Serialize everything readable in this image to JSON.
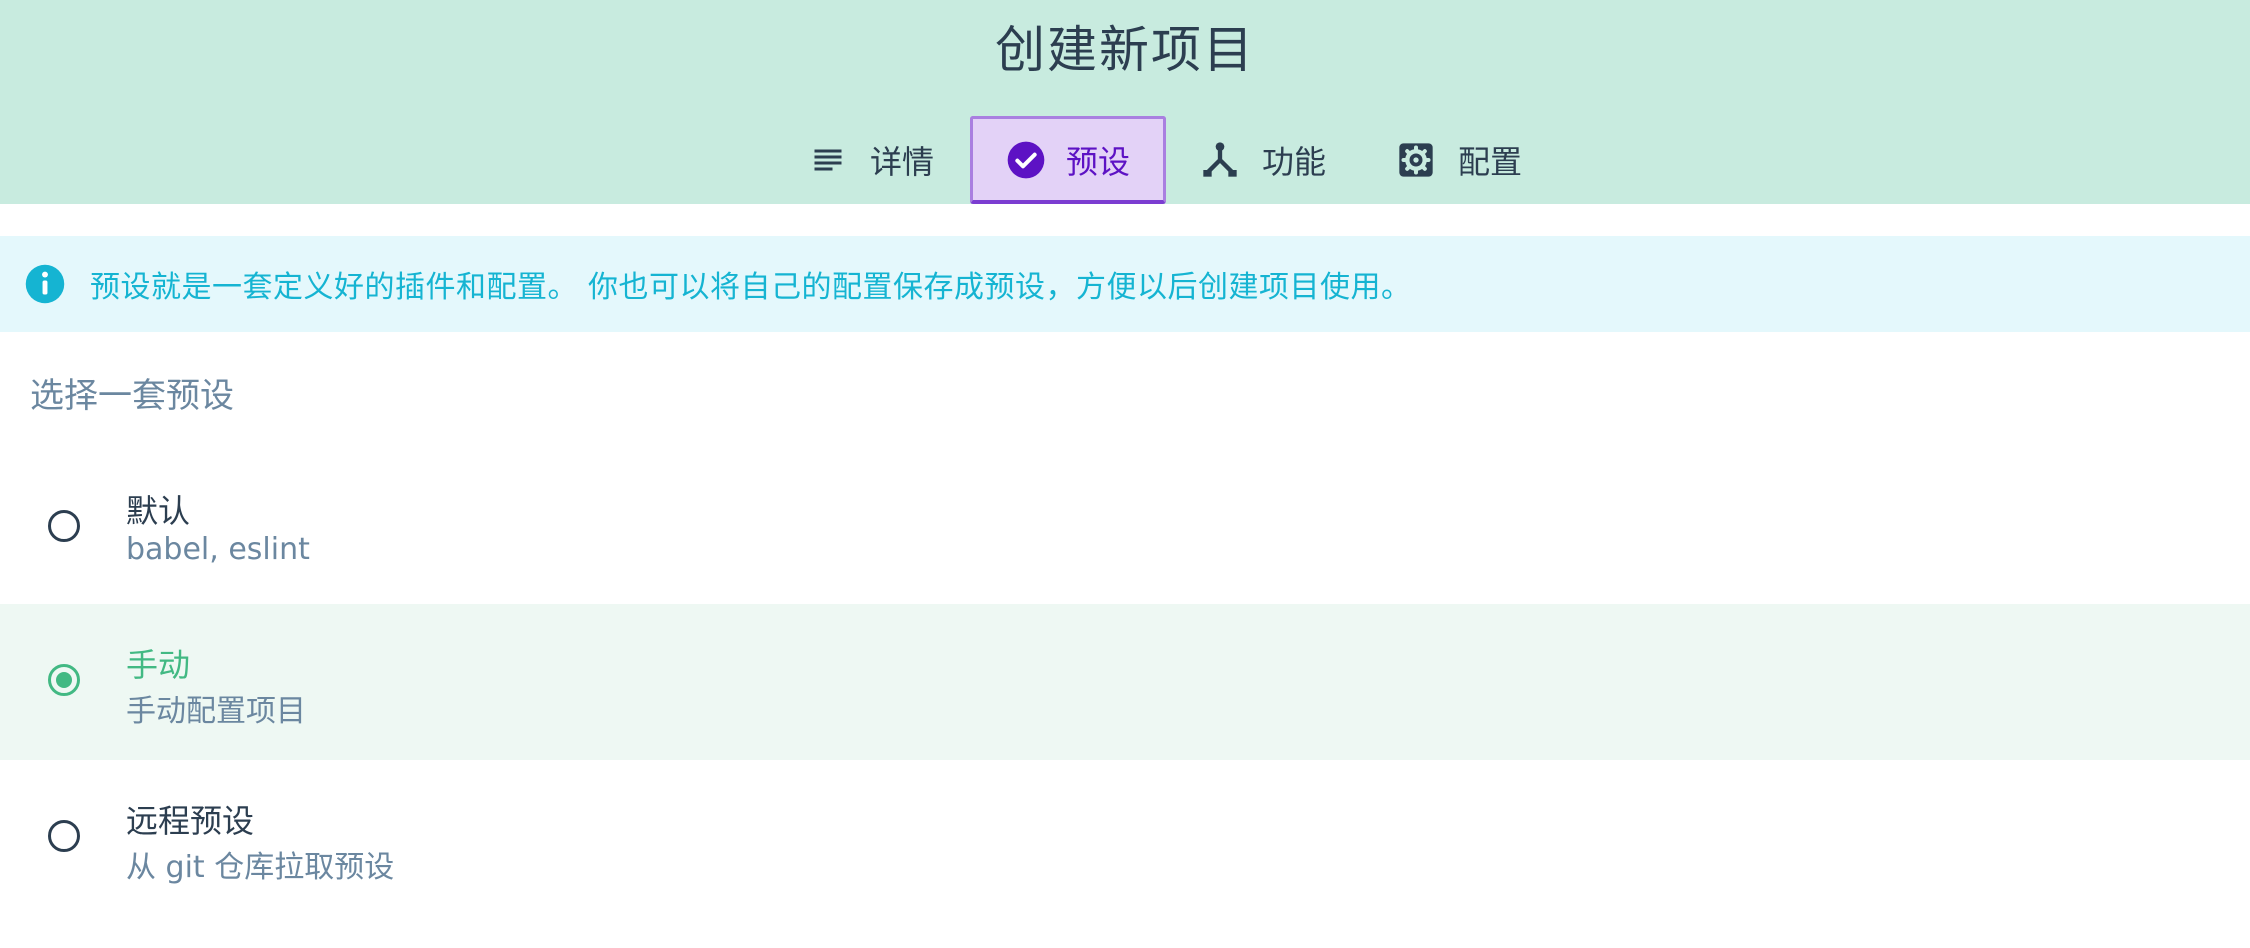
{
  "header": {
    "title": "创建新项目",
    "tabs": [
      {
        "label": "详情",
        "icon": "subject-icon"
      },
      {
        "label": "预设",
        "icon": "check-circle-icon",
        "active": true
      },
      {
        "label": "功能",
        "icon": "call-split-icon"
      },
      {
        "label": "配置",
        "icon": "settings-box-icon"
      }
    ]
  },
  "info": {
    "text": "预设就是一套定义好的插件和配置。 你也可以将自己的配置保存成预设，方便以后创建项目使用。",
    "icon": "info-icon"
  },
  "section_title": "选择一套预设",
  "presets": [
    {
      "name": "默认",
      "description": "babel, eslint",
      "selected": false
    },
    {
      "name": "手动",
      "description": "手动配置项目",
      "selected": true
    },
    {
      "name": "远程预设",
      "description": "从 git 仓库拉取预设",
      "selected": false
    }
  ],
  "colors": {
    "header_bg": "#c8ebdf",
    "accent_purple": "#5d12c4",
    "accent_green": "#42b983",
    "info_blue": "#15b4d2",
    "info_bg": "#e4f8fc"
  }
}
